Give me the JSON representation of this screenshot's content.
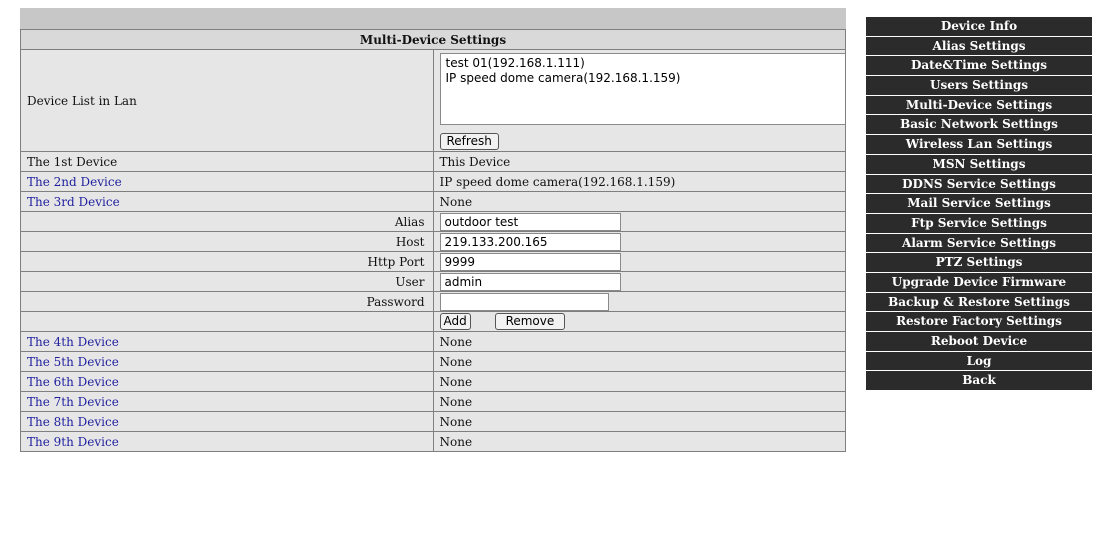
{
  "page": {
    "title": "Multi-Device Settings"
  },
  "device_list": {
    "label": "Device List in Lan",
    "items": [
      "test 01(192.168.1.111)",
      "IP speed dome camera(192.168.1.159)"
    ],
    "refresh_label": "Refresh"
  },
  "devices": {
    "d1": {
      "label": "The 1st Device",
      "value": "This Device"
    },
    "d2": {
      "label": "The 2nd Device",
      "value": "IP speed dome camera(192.168.1.159)"
    },
    "d3": {
      "label": "The 3rd Device",
      "value": "None"
    },
    "d4": {
      "label": "The 4th Device",
      "value": "None"
    },
    "d5": {
      "label": "The 5th Device",
      "value": "None"
    },
    "d6": {
      "label": "The 6th Device",
      "value": "None"
    },
    "d7": {
      "label": "The 7th Device",
      "value": "None"
    },
    "d8": {
      "label": "The 8th Device",
      "value": "None"
    },
    "d9": {
      "label": "The 9th Device",
      "value": "None"
    }
  },
  "form": {
    "alias_label": "Alias",
    "alias_value": "outdoor test",
    "host_label": "Host",
    "host_value": "219.133.200.165",
    "port_label": "Http Port",
    "port_value": "9999",
    "user_label": "User",
    "user_value": "admin",
    "password_label": "Password",
    "password_value": "",
    "add_label": "Add",
    "remove_label": "Remove"
  },
  "sidebar": {
    "items": [
      "Device Info",
      "Alias Settings",
      "Date&Time Settings",
      "Users Settings",
      "Multi-Device Settings",
      "Basic Network Settings",
      "Wireless Lan Settings",
      "MSN Settings",
      "DDNS Service Settings",
      "Mail Service Settings",
      "Ftp Service Settings",
      "Alarm Service Settings",
      "PTZ Settings",
      "Upgrade Device Firmware",
      "Backup & Restore Settings",
      "Restore Factory Settings",
      "Reboot Device",
      "Log",
      "Back"
    ]
  },
  "colors": {
    "sidebar_bg": "#2b2b2b",
    "table_bg": "#e6e6e6",
    "link": "#1f1f9e"
  }
}
